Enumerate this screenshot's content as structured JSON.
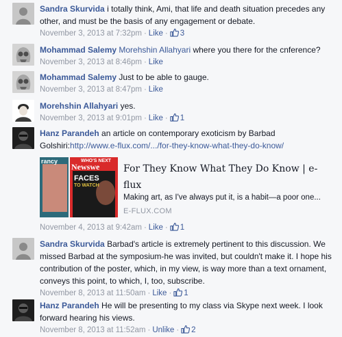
{
  "comments": [
    {
      "author": "Sandra Skurvida",
      "text": "i totally think, Ami, that life and death situation precedes any other, and must be the basis of any engagement or debate.",
      "time": "November 3, 2013 at 7:32pm",
      "action": "Like",
      "likes": "3"
    },
    {
      "author": "Mohammad Salemy",
      "mention": "Morehshin Allahyari",
      "text": "where you there for the cnference?",
      "time": "November 3, 2013 at 8:46pm",
      "action": "Like"
    },
    {
      "author": "Mohammad Salemy",
      "text": "Just to be able to gauge.",
      "time": "November 3, 2013 at 8:47pm",
      "action": "Like"
    },
    {
      "author": "Morehshin Allahyari",
      "text": "yes.",
      "time": "November 3, 2013 at 9:01pm",
      "action": "Like",
      "likes": "1"
    },
    {
      "author": "Hanz Parandeh",
      "text_before": "an article on contemporary exoticism by Barbad",
      "text_line2": "Golshiri:",
      "link": "http://www.e-flux.com/.../for-they-know-what-they-do-know/",
      "preview": {
        "title": "For They Know What They Do Know | e-flux",
        "description": "Making art, as I've always put it, is a habit—a poor one...",
        "domain": "E-FLUX.COM",
        "image_text_1": "rancy",
        "image_text_2": "WHO'S NEXT",
        "image_text_3": "Newswe",
        "image_text_4": "FACES",
        "image_text_5": "TO WATCH"
      },
      "time": "November 4, 2013 at 9:42am",
      "action": "Like",
      "likes": "1"
    },
    {
      "author": "Sandra Skurvida",
      "text": "Barbad's article is extremely pertinent to this discussion. We missed Barbad at the symposium-he was invited, but couldn't make it. I hope his contribution of the poster, which, in my view, is way more than a text ornament, conveys this point, to which, I, too, subscribe.",
      "time": "November 8, 2013 at 11:50am",
      "action": "Like",
      "likes": "1"
    },
    {
      "author": "Hanz Parandeh",
      "text": "He will be presenting to my class via Skype next week. I look forward hearing his views.",
      "time": "November 8, 2013 at 11:52am",
      "action": "Unlike",
      "likes": "2"
    }
  ],
  "separator": "·",
  "colors": {
    "link": "#3b5998",
    "meta": "#9197a3",
    "background": "#f6f7f9"
  },
  "icons": [
    "thumbs-up-icon"
  ]
}
